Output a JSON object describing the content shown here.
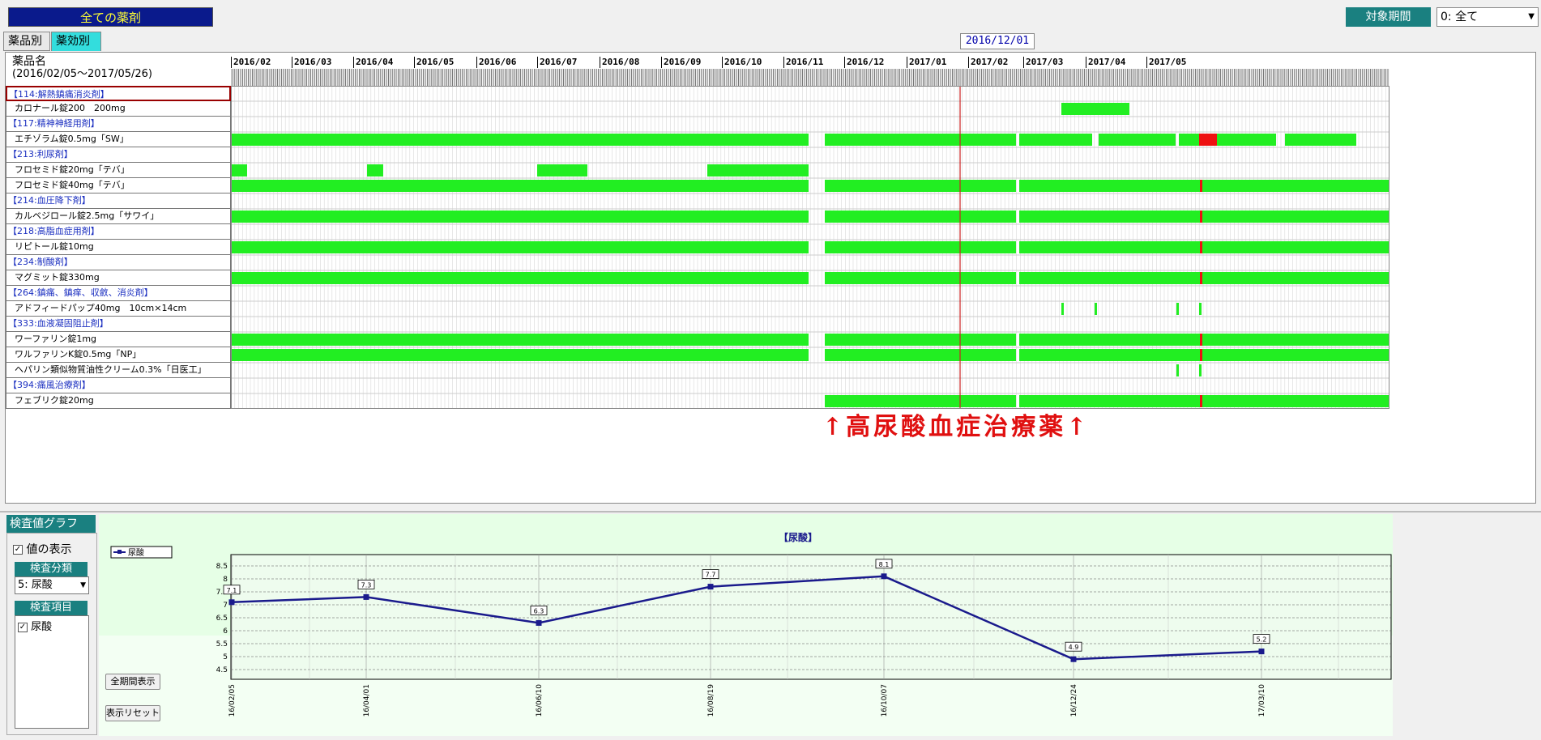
{
  "header": {
    "title": "全ての薬剤",
    "period_label": "対象期間",
    "period_value": "0: 全て"
  },
  "tabs": [
    {
      "label": "薬品別"
    },
    {
      "label": "薬効別"
    }
  ],
  "current_date_label": "2016/12/01",
  "table": {
    "name_header": "薬品名",
    "range_label": "(2016/02/05～2017/05/26)",
    "months": [
      "2016/02",
      "2016/03",
      "2016/04",
      "2016/05",
      "2016/06",
      "2016/07",
      "2016/08",
      "2016/09",
      "2016/10",
      "2016/11",
      "2016/12",
      "2017/01",
      "2017/02",
      "2017/03",
      "2017/04",
      "2017/05"
    ],
    "rows": [
      {
        "label": "【114:解熱鎮痛消炎剤】",
        "type": "category"
      },
      {
        "label": "カロナール錠200　200mg",
        "type": "drug"
      },
      {
        "label": "【117:精神神経用剤】",
        "type": "category"
      },
      {
        "label": "エチゾラム錠0.5mg「SW」",
        "type": "drug"
      },
      {
        "label": "【213:利尿剤】",
        "type": "category"
      },
      {
        "label": "フロセミド錠20mg「テバ」",
        "type": "drug"
      },
      {
        "label": "フロセミド錠40mg「テバ」",
        "type": "drug"
      },
      {
        "label": "【214:血圧降下剤】",
        "type": "category"
      },
      {
        "label": "カルベジロール錠2.5mg「サワイ」",
        "type": "drug"
      },
      {
        "label": "【218:高脂血症用剤】",
        "type": "category"
      },
      {
        "label": "リピトール錠10mg",
        "type": "drug"
      },
      {
        "label": "【234:制酸剤】",
        "type": "category"
      },
      {
        "label": "マグミット錠330mg",
        "type": "drug"
      },
      {
        "label": "【264:鎮痛、鎮痒、収斂、消炎剤】",
        "type": "category"
      },
      {
        "label": "アドフィードパップ40mg　10cm×14cm",
        "type": "drug"
      },
      {
        "label": "【333:血液凝固阻止剤】",
        "type": "category"
      },
      {
        "label": "ワーファリン錠1mg",
        "type": "drug"
      },
      {
        "label": "ワルファリンK錠0.5mg「NP」",
        "type": "drug"
      },
      {
        "label": "ヘパリン類似物質油性クリーム0.3%「日医工」",
        "type": "drug"
      },
      {
        "label": "【394:痛風治療剤】",
        "type": "category"
      },
      {
        "label": "フェブリク錠20mg",
        "type": "drug"
      }
    ]
  },
  "annotation": "↑高尿酸血症治療薬↑",
  "colors": {
    "prescribed": "#22ee22",
    "overlap": "#ee1111",
    "marker_line": "#cc2222",
    "chart_line": "#1a1a8c",
    "chart_bg": "#e6ffe6"
  },
  "graph_panel": {
    "title": "検査値グラフ",
    "show_values_label": "値の表示",
    "show_values_checked": true,
    "category_label": "検査分類",
    "category_value": "5: 尿酸",
    "item_label": "検査項目",
    "items": [
      {
        "label": "尿酸",
        "checked": true
      }
    ],
    "btn_full_period": "全期間表示",
    "btn_reset": "表示リセット"
  },
  "chart_data": {
    "type": "line",
    "title": "【尿酸】",
    "series": [
      {
        "name": "尿酸",
        "x": [
          "16/02/05",
          "16/04/01",
          "16/06/10",
          "16/08/19",
          "16/10/07",
          "16/12/24",
          "17/03/10"
        ],
        "values": [
          7.1,
          7.3,
          6.3,
          7.7,
          8.1,
          4.9,
          5.2
        ]
      }
    ],
    "ylim": [
      4.5,
      8.5
    ],
    "yticks": [
      "4.5",
      "5",
      "5.5",
      "6",
      "6.5",
      "7",
      "7.5",
      "8",
      "8.5"
    ],
    "grid": true,
    "legend": "top-left"
  }
}
